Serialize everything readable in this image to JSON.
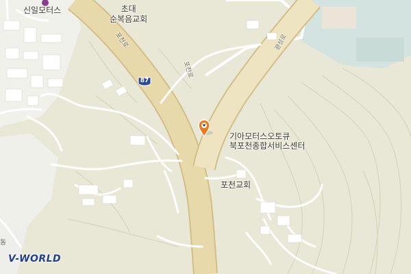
{
  "map": {
    "colors": {
      "land": "#e9e8d6",
      "urban": "#f1f1ec",
      "water": "#d3e3df",
      "major_road": "#e8d9ab",
      "road_outline": "#d2bf88",
      "minor_road": "#ffffff",
      "contour": "#d7d4bd",
      "building": "#ffffff"
    },
    "labels": {
      "shinil_motors": "신일모터스",
      "chodae_church": "초대\n순복음교회",
      "kia_service": "기아모터스오토큐\n북포천종합서비스센터",
      "pocheon_church": "포천교회",
      "road_west": "포천로",
      "road_mid": "포천로",
      "road_east": "광성로",
      "edge_glyph": "동"
    },
    "route_shield": {
      "number": "87",
      "color": "#2e4b93"
    },
    "marker": {
      "icon": "location-pin-icon",
      "color": "#f07a1a"
    },
    "logo": {
      "text": "V-WORLD"
    }
  }
}
